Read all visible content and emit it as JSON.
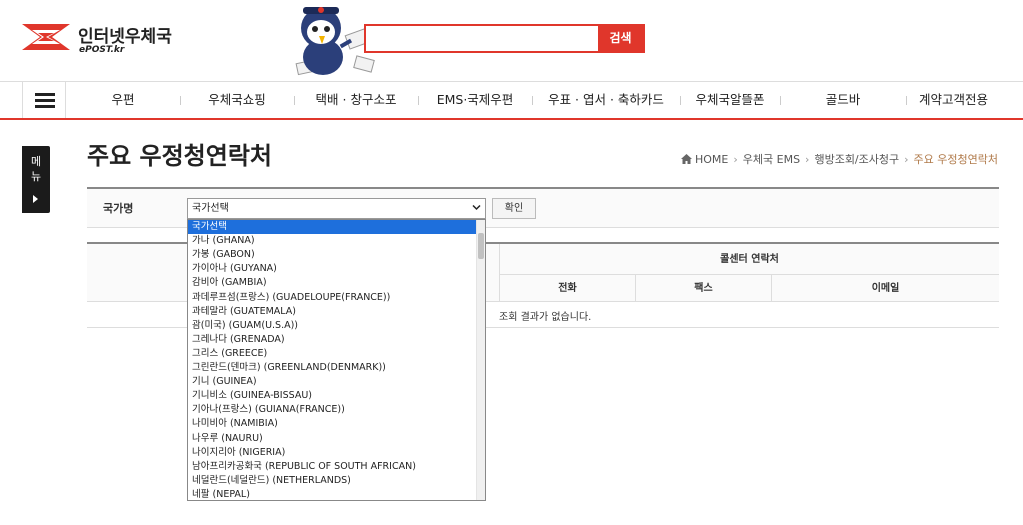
{
  "header": {
    "logo_ko": "인터넷우체국",
    "logo_en": "ePOST.kr",
    "search_value": "",
    "search_button": "검색"
  },
  "nav": {
    "items": [
      "우편",
      "우체국쇼핑",
      "택배 · 창구소포",
      "EMS·국제우편",
      "우표 · 엽서 · 축하카드",
      "우체국알뜰폰",
      "골드바",
      "계약고객전용"
    ]
  },
  "side_tab": {
    "label": "메\n뉴"
  },
  "page": {
    "title": "주요 우정청연락처",
    "breadcrumb": [
      "HOME",
      "우체국 EMS",
      "행방조회/조사청구",
      "주요 우정청연락처"
    ]
  },
  "form": {
    "label": "국가명",
    "selected": "국가선택",
    "confirm": "확인"
  },
  "table": {
    "group_header": "콜센터 연락처",
    "columns": [
      "전화",
      "팩스",
      "이메일"
    ],
    "empty_message": "조회 결과가 없습니다."
  },
  "dropdown": {
    "options": [
      "국가선택",
      "가나 (GHANA)",
      "가봉 (GABON)",
      "가이아나 (GUYANA)",
      "감비아 (GAMBIA)",
      "과데루프섬(프랑스) (GUADELOUPE(FRANCE))",
      "과테말라 (GUATEMALA)",
      "괌(미국) (GUAM(U.S.A))",
      "그레나다 (GRENADA)",
      "그리스 (GREECE)",
      "그린란드(덴마크) (GREENLAND(DENMARK))",
      "기니 (GUINEA)",
      "기니비소 (GUINEA-BISSAU)",
      "기아나(프랑스) (GUIANA(FRANCE))",
      "나미비아 (NAMIBIA)",
      "나우루 (NAURU)",
      "나이지리아 (NIGERIA)",
      "남아프리카공화국 (REPUBLIC OF SOUTH AFRICAN)",
      "네덜란드(네덜란드) (NETHERLANDS)",
      "네팔 (NEPAL)"
    ],
    "highlighted_index": 0
  },
  "colors": {
    "accent": "#e0362b",
    "highlight": "#1e6fdc",
    "breadcrumb_current": "#b07a4a"
  }
}
